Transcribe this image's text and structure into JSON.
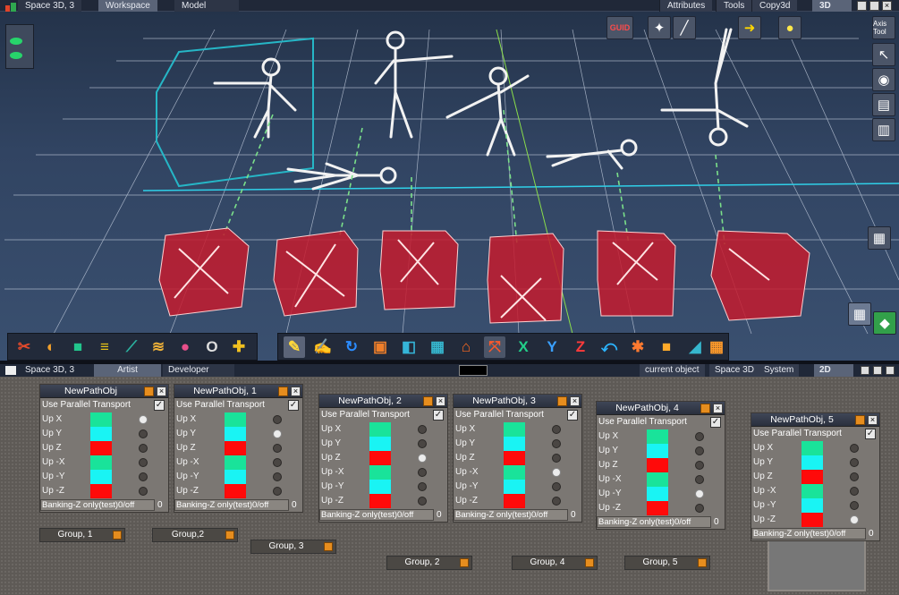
{
  "top_bar": {
    "window_title": "Space 3D, 3",
    "tabs": [
      "Workspace",
      "Model"
    ],
    "menus": [
      "Attributes",
      "Tools",
      "Copy3d"
    ],
    "mode": "3D"
  },
  "viewport": {
    "left_tools": [
      "light-icon"
    ],
    "top_right_tools": [
      "GUID",
      "Axis Tool"
    ],
    "side_labels": {
      "axis": "Axis Tool"
    }
  },
  "bottom_bar": {
    "window_title": "Space 3D, 3",
    "tabs": [
      "Artist",
      "Developer"
    ],
    "menus": [
      "current object",
      "Space 3D",
      "System"
    ],
    "mode": "2D"
  },
  "nodes": [
    {
      "title": "NewPathObj",
      "transport_label": "Use Parallel Transport",
      "checked": true,
      "rows": [
        {
          "label": "Up X",
          "color": "#19e39a",
          "on": true
        },
        {
          "label": "Up Y",
          "color": "#19f4f4",
          "on": false
        },
        {
          "label": "Up Z",
          "color": "#ff0a0a",
          "on": false
        },
        {
          "label": "Up -X",
          "color": "#19e39a",
          "on": false
        },
        {
          "label": "Up -Y",
          "color": "#19f4f4",
          "on": false
        },
        {
          "label": "Up -Z",
          "color": "#ff0a0a",
          "on": false
        }
      ],
      "banking": "Banking-Z only(test)0/off",
      "banking_value": "0"
    },
    {
      "title": "NewPathObj, 1",
      "transport_label": "Use Parallel Transport",
      "checked": true,
      "rows": [
        {
          "label": "Up X",
          "color": "#19e39a",
          "on": false
        },
        {
          "label": "Up Y",
          "color": "#19f4f4",
          "on": true
        },
        {
          "label": "Up Z",
          "color": "#ff0a0a",
          "on": false
        },
        {
          "label": "Up -X",
          "color": "#19e39a",
          "on": false
        },
        {
          "label": "Up -Y",
          "color": "#19f4f4",
          "on": false
        },
        {
          "label": "Up -Z",
          "color": "#ff0a0a",
          "on": false
        }
      ],
      "banking": "Banking-Z only(test)0/off",
      "banking_value": "0"
    },
    {
      "title": "NewPathObj, 2",
      "transport_label": "Use Parallel Transport",
      "checked": true,
      "rows": [
        {
          "label": "Up X",
          "color": "#19e39a",
          "on": false
        },
        {
          "label": "Up Y",
          "color": "#19f4f4",
          "on": false
        },
        {
          "label": "Up Z",
          "color": "#ff0a0a",
          "on": true
        },
        {
          "label": "Up -X",
          "color": "#19e39a",
          "on": false
        },
        {
          "label": "Up -Y",
          "color": "#19f4f4",
          "on": false
        },
        {
          "label": "Up -Z",
          "color": "#ff0a0a",
          "on": false
        }
      ],
      "banking": "Banking-Z only(test)0/off",
      "banking_value": "0"
    },
    {
      "title": "NewPathObj, 3",
      "transport_label": "Use Parallel Transport",
      "checked": true,
      "rows": [
        {
          "label": "Up X",
          "color": "#19e39a",
          "on": false
        },
        {
          "label": "Up Y",
          "color": "#19f4f4",
          "on": false
        },
        {
          "label": "Up Z",
          "color": "#ff0a0a",
          "on": false
        },
        {
          "label": "Up -X",
          "color": "#19e39a",
          "on": true
        },
        {
          "label": "Up -Y",
          "color": "#19f4f4",
          "on": false
        },
        {
          "label": "Up -Z",
          "color": "#ff0a0a",
          "on": false
        }
      ],
      "banking": "Banking-Z only(test)0/off",
      "banking_value": "0"
    },
    {
      "title": "NewPathObj, 4",
      "transport_label": "Use Parallel Transport",
      "checked": true,
      "rows": [
        {
          "label": "Up X",
          "color": "#19e39a",
          "on": false
        },
        {
          "label": "Up Y",
          "color": "#19f4f4",
          "on": false
        },
        {
          "label": "Up Z",
          "color": "#ff0a0a",
          "on": false
        },
        {
          "label": "Up -X",
          "color": "#19e39a",
          "on": false
        },
        {
          "label": "Up -Y",
          "color": "#19f4f4",
          "on": true
        },
        {
          "label": "Up -Z",
          "color": "#ff0a0a",
          "on": false
        }
      ],
      "banking": "Banking-Z only(test)0/off",
      "banking_value": "0"
    },
    {
      "title": "NewPathObj, 5",
      "transport_label": "Use Parallel Transport",
      "checked": true,
      "rows": [
        {
          "label": "Up X",
          "color": "#19e39a",
          "on": false
        },
        {
          "label": "Up Y",
          "color": "#19f4f4",
          "on": false
        },
        {
          "label": "Up Z",
          "color": "#ff0a0a",
          "on": false
        },
        {
          "label": "Up -X",
          "color": "#19e39a",
          "on": false
        },
        {
          "label": "Up -Y",
          "color": "#19f4f4",
          "on": false
        },
        {
          "label": "Up -Z",
          "color": "#ff0a0a",
          "on": true
        }
      ],
      "banking": "Banking-Z only(test)0/off",
      "banking_value": "0"
    }
  ],
  "groups": [
    "Group, 1",
    "Group,2",
    "Group, 3",
    "Group, 2",
    "Group, 4",
    "Group, 5"
  ]
}
